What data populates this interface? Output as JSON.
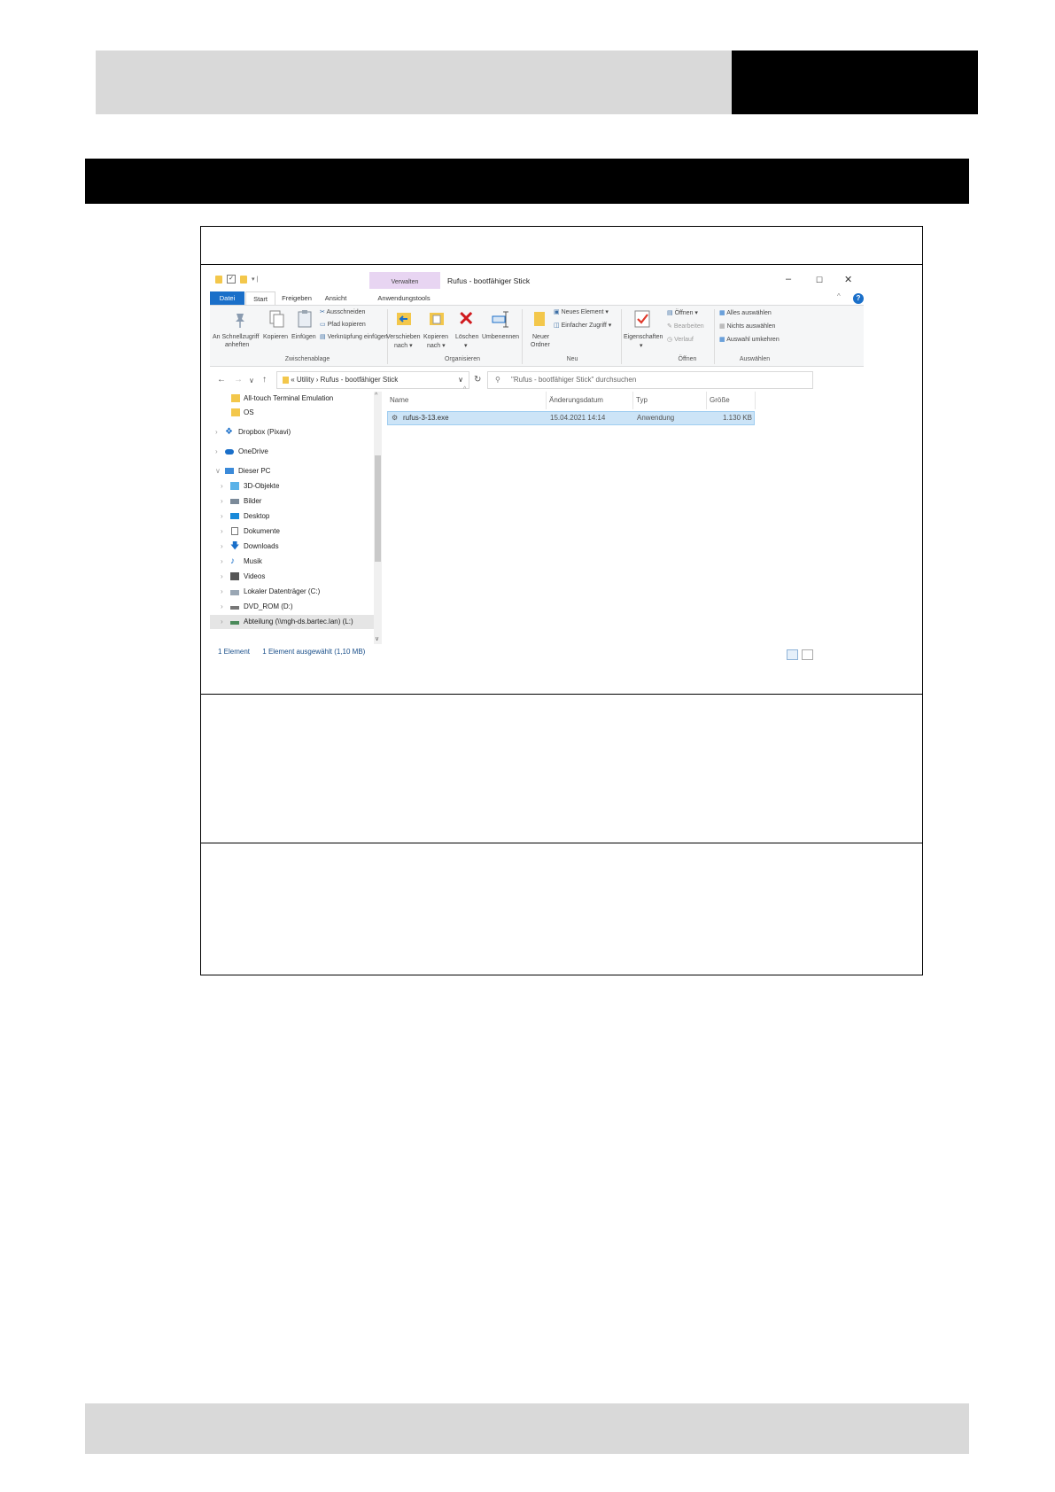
{
  "explorer": {
    "context_tab": "Verwalten",
    "title": "Rufus - bootfähiger Stick",
    "window_controls": {
      "minimize": "–",
      "maximize": "☐",
      "close": "✕"
    },
    "tabs": [
      "Datei",
      "Start",
      "Freigeben",
      "Ansicht",
      "Anwendungstools"
    ],
    "ribbon": {
      "pin": [
        "An Schnellzugriff",
        "anheften"
      ],
      "copy": "Kopieren",
      "paste": "Einfügen",
      "cut": "Ausschneiden",
      "copy_path": "Pfad kopieren",
      "paste_shortcut": "Verknüpfung einfügen",
      "group_clipboard": "Zwischenablage",
      "move": [
        "Verschieben",
        "nach ▾"
      ],
      "copy_to": [
        "Kopieren",
        "nach ▾"
      ],
      "delete": [
        "Löschen",
        "▾"
      ],
      "rename": "Umbenennen",
      "group_organize": "Organisieren",
      "new_folder": [
        "Neuer",
        "Ordner"
      ],
      "new_item": "Neues Element ▾",
      "easy_access": "Einfacher Zugriff ▾",
      "group_new": "Neu",
      "properties": [
        "Eigenschaften",
        "▾"
      ],
      "open": "Öffnen ▾",
      "edit": "Bearbeiten",
      "history": "Verlauf",
      "group_open": "Öffnen",
      "select_all": "Alles auswählen",
      "select_none": "Nichts auswählen",
      "invert_selection": "Auswahl umkehren",
      "group_select": "Auswählen"
    },
    "address": {
      "prefix": "«",
      "parent": "Utility",
      "separator": "›",
      "current": "Rufus - bootfähiger Stick"
    },
    "search_placeholder": "\"Rufus - bootfähiger Stick\" durchsuchen",
    "tree": [
      "All-touch Terminal Emulation",
      "OS",
      "Dropbox (Pixavi)",
      "OneDrive",
      "Dieser PC",
      "3D-Objekte",
      "Bilder",
      "Desktop",
      "Dokumente",
      "Downloads",
      "Musik",
      "Videos",
      "Lokaler Datenträger (C:)",
      "DVD_ROM (D:)",
      "Abteilung (\\\\mgh-ds.bartec.lan) (L:)"
    ],
    "columns": [
      "Name",
      "Änderungsdatum",
      "Typ",
      "Größe"
    ],
    "files": [
      {
        "name": "rufus-3-13.exe",
        "date": "15.04.2021 14:14",
        "type": "Anwendung",
        "size": "1.130 KB"
      }
    ],
    "status_count": "1 Element",
    "status_selected": "1 Element ausgewählt (1,10 MB)",
    "colors": {
      "accent": "#1a6fc9",
      "selection": "#cce4f7",
      "context_tab": "#e8d5f2"
    }
  }
}
